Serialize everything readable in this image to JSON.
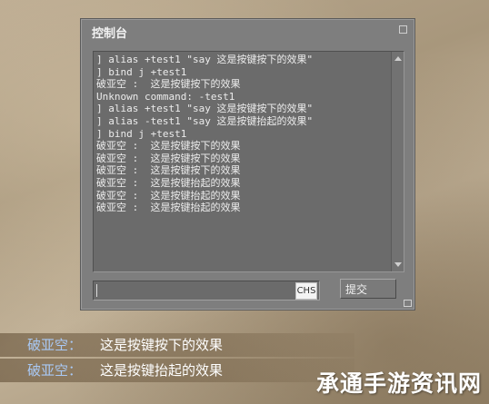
{
  "console": {
    "title": "控制台",
    "lines": [
      "] alias +test1 \"say 这是按键按下的效果\"",
      "] bind j +test1",
      "破亚空 :  这是按键按下的效果",
      "Unknown command: -test1",
      "] alias +test1 \"say 这是按键按下的效果\"",
      "] alias -test1 \"say 这是按键抬起的效果\"",
      "] bind j +test1",
      "破亚空 :  这是按键按下的效果",
      "破亚空 :  这是按键按下的效果",
      "破亚空 :  这是按键按下的效果",
      "破亚空 :  这是按键抬起的效果",
      "破亚空 :  这是按键抬起的效果",
      "破亚空 :  这是按键抬起的效果"
    ],
    "input_value": "",
    "ime_label": "CHS",
    "submit_label": "提交"
  },
  "chat": [
    {
      "name": "破亚空：",
      "message": "这是按键按下的效果"
    },
    {
      "name": "破亚空：",
      "message": "这是按键抬起的效果"
    }
  ],
  "watermark": "承通手游资讯网",
  "colors": {
    "console_bg": "#7e7e7e",
    "chat_name": "#a9c9f5",
    "chat_text": "#ffffff"
  }
}
